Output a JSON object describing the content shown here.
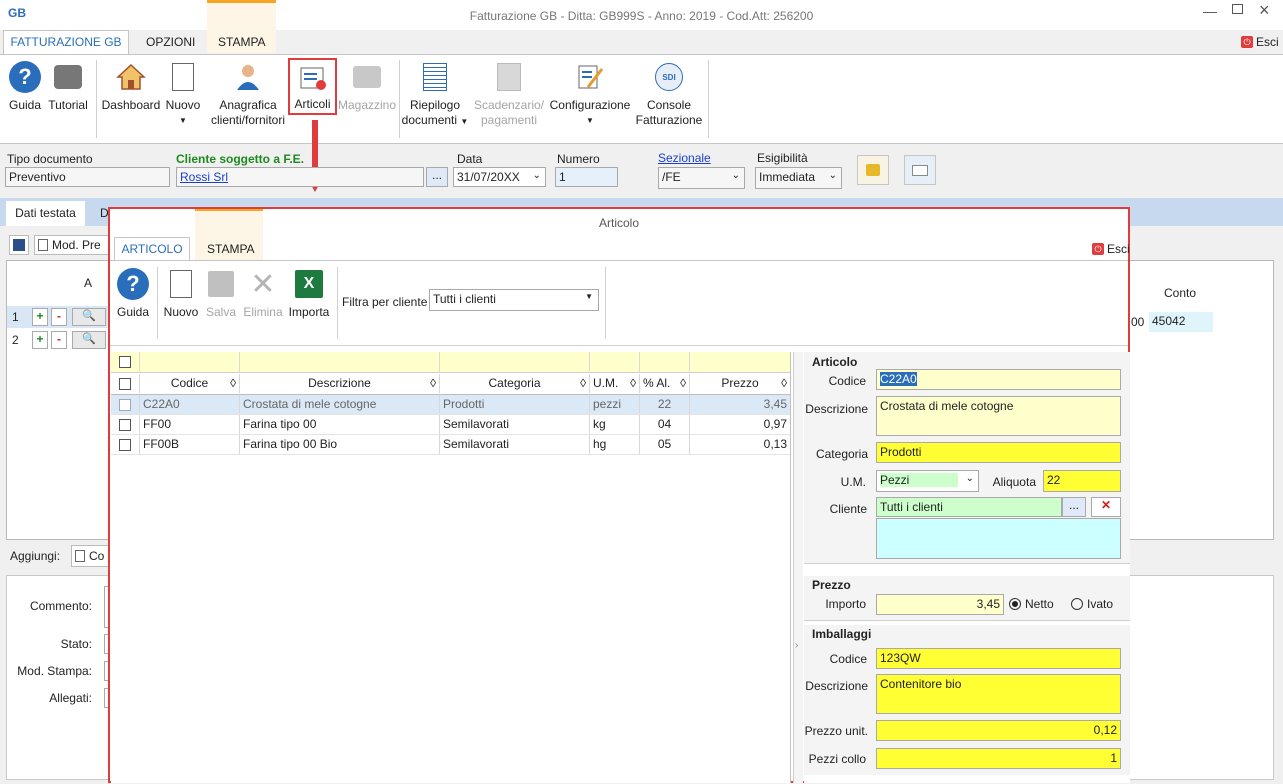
{
  "app": {
    "title": "Fatturazione GB - Ditta: GB999S - Anno: 2019 - Cod.Att: 256200",
    "esci": "Esci"
  },
  "ribbon_tabs": [
    "FATTURAZIONE GB",
    "OPZIONI",
    "STAMPA"
  ],
  "toolbar": {
    "guida": "Guida",
    "tutorial": "Tutorial",
    "dashboard": "Dashboard",
    "nuovo": "Nuovo",
    "anagrafica": "Anagrafica",
    "anagrafica2": "clienti/fornitori",
    "articoli": "Articoli",
    "magazzino": "Magazzino",
    "riepilogo": "Riepilogo",
    "riepilogo2": "documenti",
    "scadenzario": "Scadenzario/",
    "scadenzario2": "pagamenti",
    "configurazione": "Configurazione",
    "console": "Console",
    "console2": "Fatturazione",
    "sdi": "SDI"
  },
  "doc": {
    "tipo_label": "Tipo documento",
    "tipo_value": "Preventivo",
    "cliente_label": "Cliente soggetto a F.E.",
    "cliente_value": "Rossi Srl",
    "data_label": "Data",
    "data_value": "31/07/20XX",
    "numero_label": "Numero",
    "numero_value": "1",
    "sezionale_label": "Sezionale",
    "sezionale_value": "/FE",
    "esig_label": "Esigibilità",
    "esig_value": "Immediata",
    "browse": "..."
  },
  "bg_tabs": {
    "dati_testata": "Dati testata",
    "d2": "D"
  },
  "bg": {
    "mod_pre": "Mod. Pre",
    "col_a": "A",
    "row1": "1",
    "row2": "2",
    "plus": "+",
    "minus": "-",
    "conto_header": "Conto",
    "conto_value": "45042",
    "conto_prefix": "00",
    "aggiungi": "Aggiungi:",
    "co": "Co",
    "commento": "Commento:",
    "stato": "Stato:",
    "mod_stampa": "Mod. Stampa:",
    "allegati": "Allegati:"
  },
  "dialog": {
    "title": "Articolo",
    "tabs": [
      "ARTICOLO",
      "STAMPA"
    ],
    "esci": "Esci",
    "guida": "Guida",
    "nuovo": "Nuovo",
    "salva": "Salva",
    "elimina": "Elimina",
    "importa": "Importa",
    "filtro_label": "Filtra per cliente",
    "filtro_value": "Tutti i clienti"
  },
  "table": {
    "headers": [
      "Codice",
      "Descrizione",
      "Categoria",
      "U.M.",
      "% Al.",
      "Prezzo"
    ],
    "rows": [
      [
        "C22A0",
        "Crostata di mele cotogne",
        "Prodotti",
        "pezzi",
        "22",
        "3,45"
      ],
      [
        "FF00",
        "Farina tipo 00",
        "Semilavorati",
        "kg",
        "04",
        "0,97"
      ],
      [
        "FF00B",
        "Farina tipo 00 Bio",
        "Semilavorati",
        "hg",
        "05",
        "0,13"
      ]
    ]
  },
  "detail": {
    "articolo_section": "Articolo",
    "codice_label": "Codice",
    "codice_value": "C22A0",
    "descrizione_label": "Descrizione",
    "descrizione_value": "Crostata di mele cotogne",
    "categoria_label": "Categoria",
    "categoria_value": "Prodotti",
    "um_label": "U.M.",
    "um_value": "Pezzi",
    "aliquota_label": "Aliquota",
    "aliquota_value": "22",
    "cliente_label": "Cliente",
    "cliente_value": "Tutti i clienti",
    "cliente_browse": "...",
    "prezzo_section": "Prezzo",
    "importo_label": "Importo",
    "importo_value": "3,45",
    "netto": "Netto",
    "ivato": "Ivato",
    "imballaggi_section": "Imballaggi",
    "imb_codice_label": "Codice",
    "imb_codice_value": "123QW",
    "imb_desc_label": "Descrizione",
    "imb_desc_value": "Contenitore bio",
    "prezzo_unit_label": "Prezzo unit.",
    "prezzo_unit_value": "0,12",
    "pezzi_collo_label": "Pezzi collo",
    "pezzi_collo_value": "1"
  },
  "colors": {
    "highlight_red": "#e03c3c",
    "accent_blue": "#2a6ebb",
    "field_yellow": "#ffff33"
  }
}
